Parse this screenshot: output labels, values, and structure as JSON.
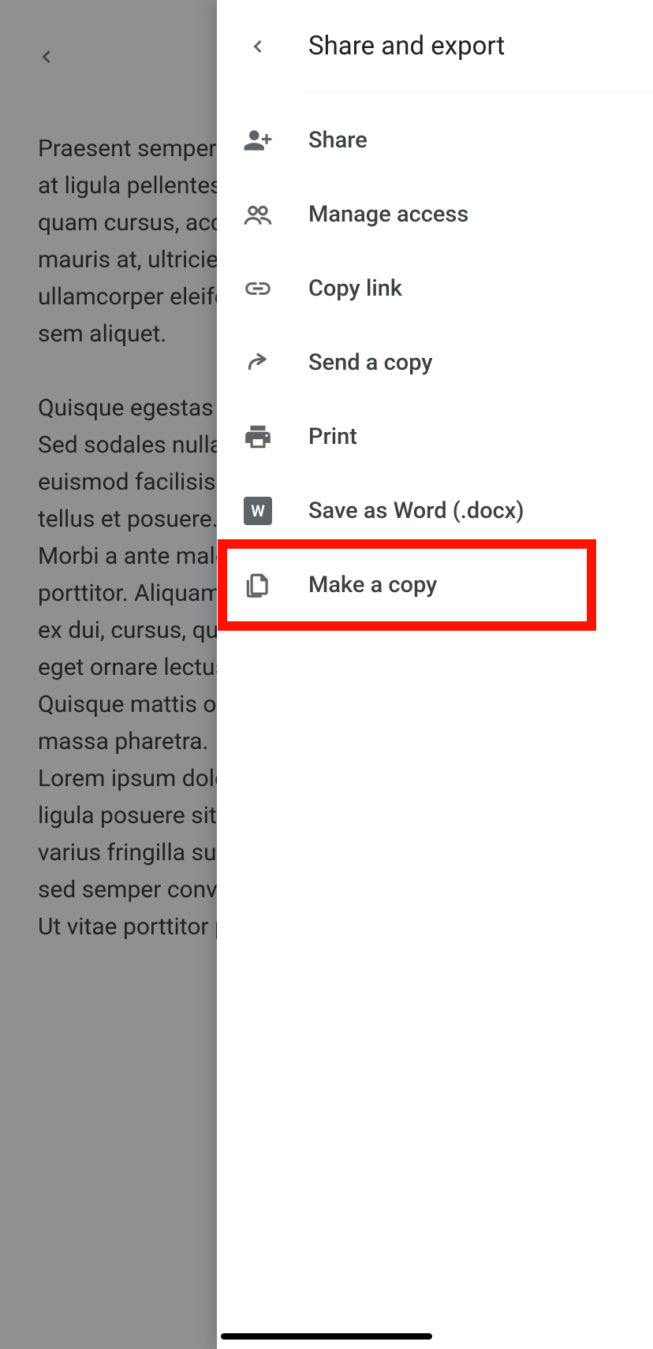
{
  "document": {
    "paragraphs": [
      "Praesent semper cursus mi, eget dictum eget. Fusce at ligula pellentesque, sed commodo leo. Praesent a quam cursus, accumsan neque. Mauris libero, ac mauris at, ultricies rutrum sodales lacus a orci ullamcorper eleifend. Duis pretium diam mollis erat vel sem aliquet.",
      "Quisque egestas a leo vitae consequat ante porttitor. Sed sodales nulla lacinia, urna et consequat posuere euismod facilisis nunc. Phasellus semper placerat tellus et posuere. Ut interdum massa vitae libero porta. Morbi a ante malesuada nec eget eros. Aenean vitae porttitor. Aliquam scelerisque et imperdiet tincidunt. In ex dui, cursus, quis vulputate pharetra facilisis erat dui, eget ornare lectus. Morbi ullamcorper volutpat. Quisque mattis odio sem, eget sollicitudin vitae. Ut vel massa pharetra.\nLorem ipsum dolor sit amet, adipiscing elit. Ut vitae ligula posuere sit amet, eu placerat lorem at ipsum varius fringilla suscipit mauris. Donec sodales efficitur, sed semper convallis, consectetur risus, ac posuere. Ut vitae porttitor purus cursus."
    ]
  },
  "panel": {
    "title": "Share and export",
    "items": [
      {
        "key": "share",
        "label": "Share"
      },
      {
        "key": "manage-access",
        "label": "Manage access"
      },
      {
        "key": "copy-link",
        "label": "Copy link"
      },
      {
        "key": "send-copy",
        "label": "Send a copy"
      },
      {
        "key": "print",
        "label": "Print"
      },
      {
        "key": "save-word",
        "label": "Save as Word (.docx)"
      },
      {
        "key": "make-copy",
        "label": "Make a copy"
      }
    ],
    "word_badge": "W"
  }
}
